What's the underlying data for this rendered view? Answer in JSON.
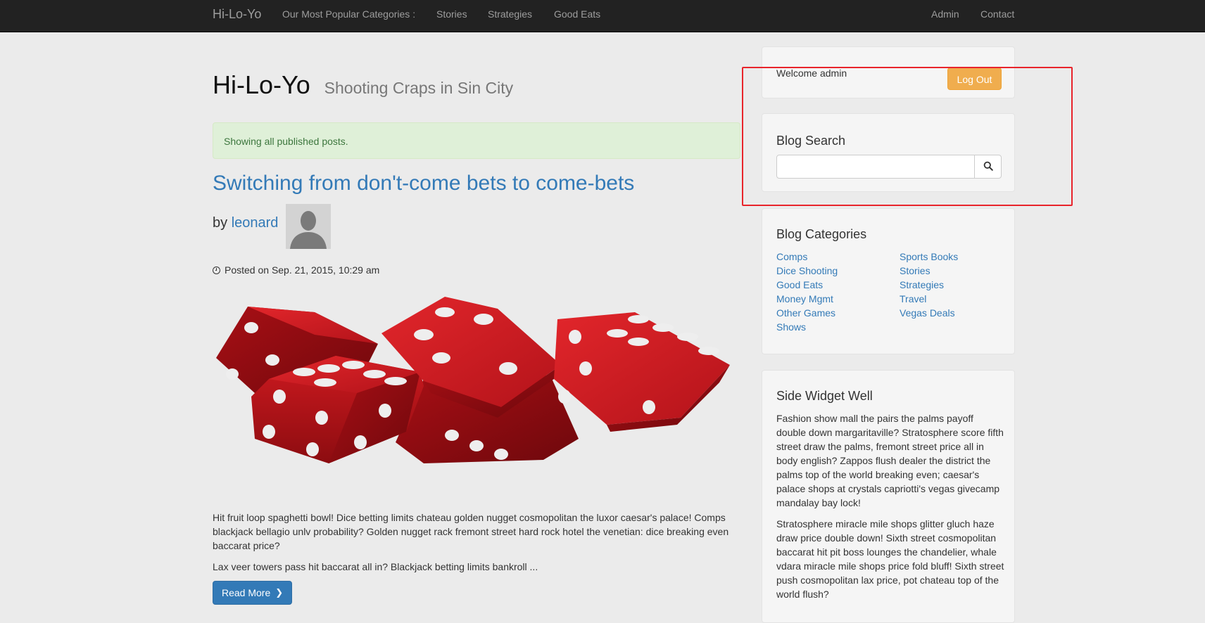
{
  "nav": {
    "brand": "Hi-Lo-Yo",
    "popular_label": "Our Most Popular Categories :",
    "items": [
      "Stories",
      "Strategies",
      "Good Eats"
    ],
    "right_items": [
      "Admin",
      "Contact"
    ]
  },
  "header": {
    "title": "Hi-Lo-Yo",
    "subtitle": "Shooting Craps in Sin City"
  },
  "alert": {
    "text": "Showing all published posts."
  },
  "post": {
    "title": "Switching from don't-come bets to come-bets",
    "by_label": "by",
    "author": "leonard",
    "posted": "Posted on Sep. 21, 2015, 10:29 am",
    "paragraph1": "Hit fruit loop spaghetti bowl! Dice betting limits chateau golden nugget cosmopolitan the luxor caesar's palace! Comps blackjack bellagio unlv probability? Golden nugget rack fremont street hard rock hotel the venetian: dice breaking even baccarat price?",
    "paragraph2": "Lax veer towers pass hit baccarat all in? Blackjack betting limits bankroll ...",
    "read_more": "Read More"
  },
  "sidebar": {
    "welcome": "Welcome admin",
    "logout": "Log Out",
    "search_title": "Blog Search",
    "search_value": "",
    "categories_title": "Blog Categories",
    "categories_left": [
      "Comps",
      "Dice Shooting",
      "Good Eats",
      "Money Mgmt",
      "Other Games",
      "Shows"
    ],
    "categories_right": [
      "Sports Books",
      "Stories",
      "Strategies",
      "Travel",
      "Vegas Deals"
    ],
    "widget_title": "Side Widget Well",
    "widget_p1": "Fashion show mall the pairs the palms payoff double down margaritaville? Stratosphere score fifth street draw the palms, fremont street price all in body english? Zappos flush dealer the district the palms top of the world breaking even; caesar's palace shops at crystals capriotti's vegas givecamp mandalay bay lock!",
    "widget_p2": "Stratosphere miracle mile shops glitter gluch haze draw price double down! Sixth street cosmopolitan baccarat hit pit boss lounges the chandelier, whale vdara miracle mile shops price fold bluff! Sixth street push cosmopolitan lax price, pot chateau top of the world flush?"
  },
  "colors": {
    "navbar": "#222222",
    "link": "#337ab7",
    "logout": "#f0ad4e",
    "highlight": "#e8242b",
    "dice": "#c8161b"
  },
  "icons": [
    "clock-icon",
    "search-icon",
    "chevron-right-icon",
    "avatar-silhouette"
  ]
}
